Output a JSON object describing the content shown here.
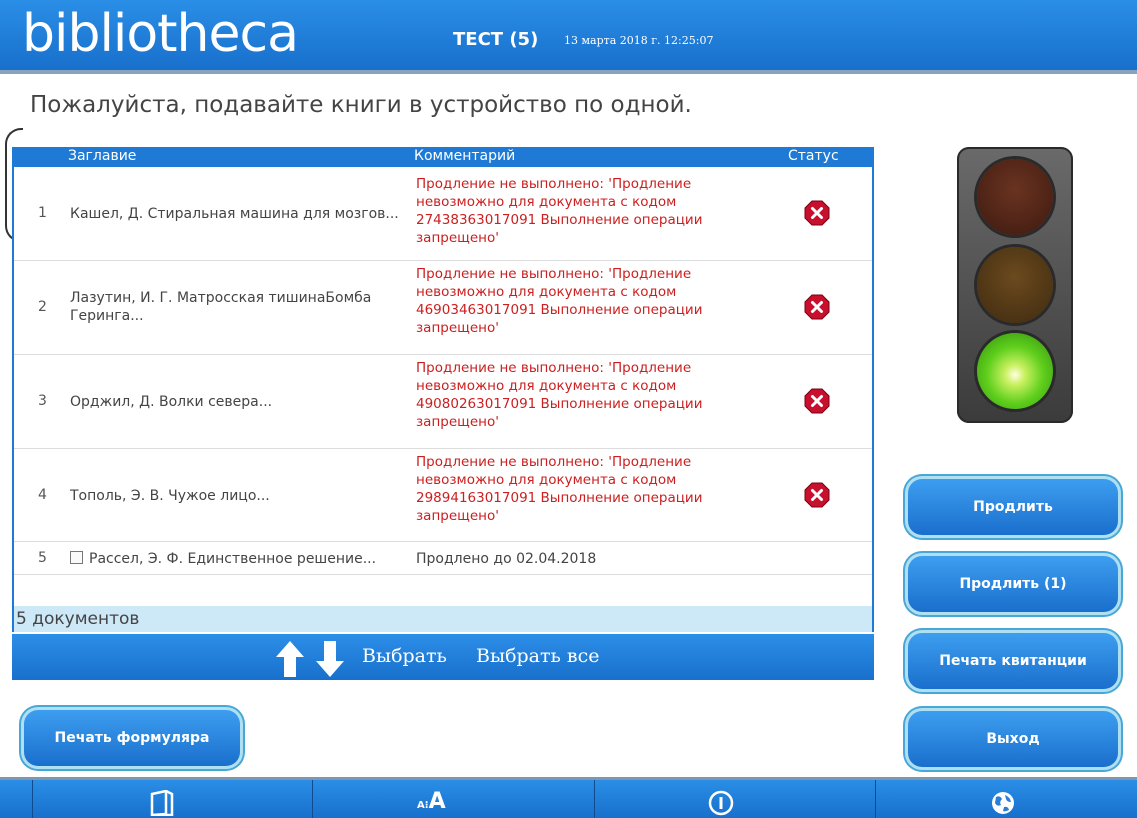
{
  "header": {
    "logo": "bibliotheca",
    "station": "ТЕСТ (5)",
    "datetime": "13 марта 2018 г. 12:25:07"
  },
  "instruction": "Пожалуйста, подавайте книги в устройство по одной.",
  "table": {
    "columns": {
      "title": "Заглавие",
      "comment": "Комментарий",
      "status": "Статус"
    },
    "rows": [
      {
        "num": "1",
        "title": "Кашел, Д. Стиральная машина для мозгов...",
        "comment": "Продление не выполнено: 'Продление невозможно для документа с кодом 27438363017091 Выполнение операции запрещено'",
        "status": "error"
      },
      {
        "num": "2",
        "title": "Лазутин, И. Г. Матросская тишинаБомба Геринга...",
        "comment": "Продление не выполнено: 'Продление невозможно для документа с кодом 46903463017091 Выполнение операции запрещено'",
        "status": "error"
      },
      {
        "num": "3",
        "title": "Орджил, Д. Волки севера...",
        "comment": "Продление не выполнено: 'Продление невозможно для документа с кодом 49080263017091 Выполнение операции запрещено'",
        "status": "error"
      },
      {
        "num": "4",
        "title": "Тополь, Э. В. Чужое лицо...",
        "comment": "Продление не выполнено: 'Продление невозможно для документа с кодом 29894163017091 Выполнение операции запрещено'",
        "status": "error"
      },
      {
        "num": "5",
        "title": "Рассел, Э. Ф. Единственное решение...",
        "comment": "Продлено до 02.04.2018",
        "status": "ok",
        "checkbox": true
      }
    ],
    "count": "5 документов",
    "select_label": "Выбрать",
    "select_all_label": "Выбрать все"
  },
  "buttons": {
    "renew": "Продлить",
    "renew_one": "Продлить (1)",
    "print_receipt": "Печать квитанции",
    "exit": "Выход",
    "print_form": "Печать формуляра"
  },
  "traffic_light": {
    "active": "green"
  },
  "footer": {
    "icons": [
      "book-icon",
      "font-size-icon",
      "info-icon",
      "globe-icon"
    ],
    "font_label": "A"
  },
  "colors": {
    "primary": "#1f7ad6",
    "error_text": "#cc1f1f",
    "error_icon": "#c8102e"
  }
}
